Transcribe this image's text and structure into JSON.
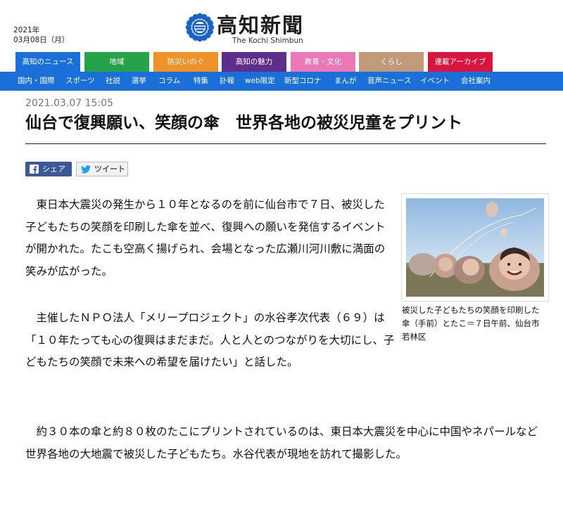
{
  "header": {
    "date_year": "2021年",
    "date_day": "03月08日（月）",
    "logo_text": "高知新聞",
    "logo_sub": "The Kochi Shimbun"
  },
  "category_nav": [
    {
      "label": "高知のニュース",
      "color": "#1a70d8"
    },
    {
      "label": "地域",
      "color": "#26a24a"
    },
    {
      "label": "防災いのぐ",
      "color": "#f0922a"
    },
    {
      "label": "高知の魅力",
      "color": "#5f2d8a"
    },
    {
      "label": "教育・文化",
      "color": "#ec78b8"
    },
    {
      "label": "くらし",
      "color": "#c09a7a"
    },
    {
      "label": "連載アーカイブ",
      "color": "#d8153f"
    }
  ],
  "sub_nav": [
    "国内・国際",
    "スポーツ",
    "社説",
    "選挙",
    "コラム",
    "特集",
    "訃報",
    "web限定",
    "新型コロナ",
    "まんが",
    "音声ニュース",
    "イベント",
    "会社案内"
  ],
  "article": {
    "published": "2021.03.07 15:05",
    "headline": "仙台で復興願い、笑顔の傘　世界各地の被災児童をプリント",
    "share_label": "シェア",
    "tweet_label": "ツイート",
    "paragraphs": [
      "　東日本大震災の発生から１０年となるのを前に仙台市で７日、被災した子どもたちの笑顔を印刷した傘を並べ、復興への願いを発信するイベントが開かれた。たこも空高く揚げられ、会場となった広瀬川河川敷に満面の笑みが広がった。",
      "　主催したＮＰＯ法人「メリープロジェクト」の水谷孝次代表（６９）は「１０年たっても心の復興はまだまだ。人と人とのつながりを大切にし、子どもたちの笑顔で未来への希望を届けたい」と話した。",
      "　約３０本の傘と約８０枚のたこにプリントされているのは、東日本大震災を中心に中国やネパールなど世界各地の大地震で被災した子どもたち。水谷代表が現地を訪れて撮影した。"
    ],
    "photo_caption": "被災した子どもたちの笑顔を印刷した傘（手前）とたこ＝７日午前、仙台市若林区"
  }
}
